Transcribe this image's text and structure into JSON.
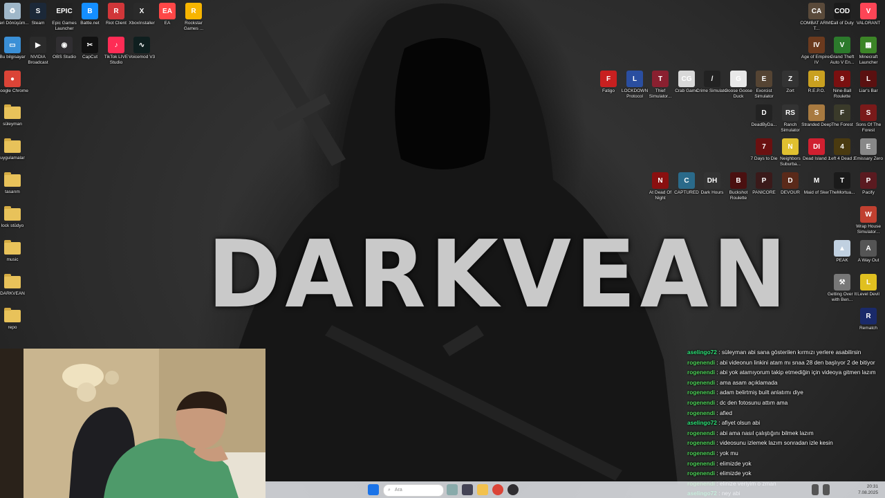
{
  "wallpaper": {
    "title": "DARKVEAN"
  },
  "desktop_left": [
    {
      "label": "Geri Dönüşüm...",
      "icon": "recycle-bin-icon",
      "color": "#9fb7c9",
      "glyph": "♻"
    },
    {
      "label": "Steam",
      "icon": "steam-icon",
      "color": "#1b2838",
      "glyph": "S"
    },
    {
      "label": "Epic Games Launcher",
      "icon": "epic-games-icon",
      "color": "#222",
      "glyph": "EPIC"
    },
    {
      "label": "Battle.net",
      "icon": "battlenet-icon",
      "color": "#148eff",
      "glyph": "B"
    },
    {
      "label": "Riot Client",
      "icon": "riot-client-icon",
      "color": "#d13639",
      "glyph": "R"
    },
    {
      "label": "XboxInstaller",
      "icon": "xbox-icon",
      "color": "#2a2a2a",
      "glyph": "X"
    },
    {
      "label": "EA",
      "icon": "ea-icon",
      "color": "#ff4747",
      "glyph": "EA"
    },
    {
      "label": "Rockstar Games ...",
      "icon": "rockstar-icon",
      "color": "#f7b500",
      "glyph": "R"
    },
    {
      "label": "Bu bilgisayar",
      "icon": "this-pc-icon",
      "color": "#3a8fd6",
      "glyph": "▭"
    },
    {
      "label": "NVIDIA Broadcast",
      "icon": "nvidia-broadcast-icon",
      "color": "#2b2b2b",
      "glyph": "▶"
    },
    {
      "label": "OBS Studio",
      "icon": "obs-icon",
      "color": "#302e31",
      "glyph": "◉"
    },
    {
      "label": "CapCut",
      "icon": "capcut-icon",
      "color": "#111",
      "glyph": "✂"
    },
    {
      "label": "TikTok LIVE Studio",
      "icon": "tiktok-icon",
      "color": "#fe2c55",
      "glyph": "♪"
    },
    {
      "label": "Voicemod V3",
      "icon": "voicemod-icon",
      "color": "#0f1f1f",
      "glyph": "∿"
    },
    {
      "label": "Google Chrome",
      "icon": "chrome-icon",
      "color": "#db4437",
      "glyph": "●"
    },
    {
      "label": "süleyman",
      "icon": "folder-icon",
      "folder": true
    },
    {
      "label": "uygulamalar",
      "icon": "folder-icon",
      "folder": true
    },
    {
      "label": "tasarım",
      "icon": "folder-icon",
      "folder": true
    },
    {
      "label": "lock stüdyo",
      "icon": "folder-icon",
      "folder": true
    },
    {
      "label": "music",
      "icon": "folder-icon",
      "folder": true
    },
    {
      "label": "DARKVEAN",
      "icon": "folder-icon",
      "folder": true
    },
    {
      "label": "repo",
      "icon": "folder-icon",
      "folder": true
    }
  ],
  "desktop_right": [
    {
      "label": "COMBAT ARMS T...",
      "icon": "combat-arms-icon",
      "color": "#5a4a3a",
      "glyph": "CA"
    },
    {
      "label": "Call of Duty",
      "icon": "call-of-duty-icon",
      "color": "#1a1a1a",
      "glyph": "COD"
    },
    {
      "label": "VALORANT",
      "icon": "valorant-icon",
      "color": "#fd4556",
      "glyph": "V"
    },
    {
      "label": "Age of Empires IV",
      "icon": "age-of-empires-icon",
      "color": "#6b3a1e",
      "glyph": "IV"
    },
    {
      "label": "Grand Theft Auto V En...",
      "icon": "gta-icon",
      "color": "#2c7a2c",
      "glyph": "V"
    },
    {
      "label": "Minecraft Launcher",
      "icon": "minecraft-icon",
      "color": "#3c8527",
      "glyph": "▦"
    },
    {
      "label": "Fatigo",
      "icon": "game-icon",
      "color": "#c82020",
      "glyph": "F"
    },
    {
      "label": "LOCKDOWN Protocol",
      "icon": "game-icon",
      "color": "#2a4ea0",
      "glyph": "L"
    },
    {
      "label": "Thief Simulator...",
      "icon": "game-icon",
      "color": "#8a2030",
      "glyph": "T"
    },
    {
      "label": "Crab Game",
      "icon": "game-icon",
      "color": "#d8d8d8",
      "glyph": "CG"
    },
    {
      "label": "Crime Simulator",
      "icon": "game-icon",
      "color": "#222",
      "glyph": "/"
    },
    {
      "label": "Goose Goose Duck",
      "icon": "game-icon",
      "color": "#e8e8e8",
      "glyph": "G"
    },
    {
      "label": "Exorcist Simulator",
      "icon": "game-icon",
      "color": "#554433",
      "glyph": "E"
    },
    {
      "label": "Zort",
      "icon": "game-icon",
      "color": "#333",
      "glyph": "Z"
    },
    {
      "label": "R.E.P.O.",
      "icon": "game-icon",
      "color": "#c9a020",
      "glyph": "R"
    },
    {
      "label": "Nine-Ball Roulette",
      "icon": "game-icon",
      "color": "#7a1010",
      "glyph": "9"
    },
    {
      "label": "Liar's Bar",
      "icon": "game-icon",
      "color": "#5a1010",
      "glyph": "L"
    },
    {
      "label": "DeadByDa...",
      "icon": "game-icon",
      "color": "#222",
      "glyph": "D"
    },
    {
      "label": "Ranch Simulator",
      "icon": "game-icon",
      "color": "#333",
      "glyph": "RS"
    },
    {
      "label": "Stranded Deep",
      "icon": "game-icon",
      "color": "#a87a40",
      "glyph": "S"
    },
    {
      "label": "The Forest",
      "icon": "game-icon",
      "color": "#3a3a2a",
      "glyph": "F"
    },
    {
      "label": "Sons Of The Forest",
      "icon": "game-icon",
      "color": "#7a1a1a",
      "glyph": "S"
    },
    {
      "label": "7 Days to Die",
      "icon": "game-icon",
      "color": "#6a1010",
      "glyph": "7"
    },
    {
      "label": "Neighbors Suburba...",
      "icon": "game-icon",
      "color": "#e0c030",
      "glyph": "N"
    },
    {
      "label": "Dead Island 2",
      "icon": "game-icon",
      "color": "#d02030",
      "glyph": "DI"
    },
    {
      "label": "Left 4 Dead 2",
      "icon": "game-icon",
      "color": "#4a3a10",
      "glyph": "4"
    },
    {
      "label": "Emissary Zero",
      "icon": "game-icon",
      "color": "#888",
      "glyph": "E"
    },
    {
      "label": "At Dead Of Night",
      "icon": "game-icon",
      "color": "#8a1010",
      "glyph": "N"
    },
    {
      "label": "CAPTURED",
      "icon": "game-icon",
      "color": "#2a6a8a",
      "glyph": "C"
    },
    {
      "label": "Dark Hours",
      "icon": "game-icon",
      "color": "#333",
      "glyph": "DH"
    },
    {
      "label": "Buckshot Roulette",
      "icon": "game-icon",
      "color": "#4a1010",
      "glyph": "B"
    },
    {
      "label": "PANICORE",
      "icon": "game-icon",
      "color": "#3a1a1a",
      "glyph": "P"
    },
    {
      "label": "DEVOUR",
      "icon": "game-icon",
      "color": "#5a2a1a",
      "glyph": "D"
    },
    {
      "label": "Maid of Sker",
      "icon": "game-icon",
      "color": "#2a2a2a",
      "glyph": "M"
    },
    {
      "label": "TheMortua...",
      "icon": "game-icon",
      "color": "#1a1a1a",
      "glyph": "T"
    },
    {
      "label": "Pacify",
      "icon": "game-icon",
      "color": "#5a1a20",
      "glyph": "P"
    },
    {
      "label": "Wrap House Simulator...",
      "icon": "game-icon",
      "color": "#c04030",
      "glyph": "W"
    },
    {
      "label": "PEAK",
      "icon": "game-icon",
      "color": "#c0d0e0",
      "glyph": "▲"
    },
    {
      "label": "A Way Out",
      "icon": "game-icon",
      "color": "#555",
      "glyph": "A"
    },
    {
      "label": "Getting Over It with Ben...",
      "icon": "game-icon",
      "color": "#777",
      "glyph": "⚒"
    },
    {
      "label": "Level Devil",
      "icon": "game-icon",
      "color": "#e0c020",
      "glyph": "L"
    },
    {
      "label": "Rematch",
      "icon": "game-icon",
      "color": "#1a2a6a",
      "glyph": "R"
    }
  ],
  "chat": [
    {
      "user": "aselingo72",
      "color": "#2ee87a",
      "msg": "süleyman abi sana gösterilen kırmızı yerlere asabilirsin"
    },
    {
      "user": "rogenendi",
      "color": "#4fd65a",
      "msg": "abi videonun linkini atam mı snaa 28 den başlıyor 2 de bitiyor"
    },
    {
      "user": "rogenendi",
      "color": "#4fd65a",
      "msg": "abi yok atamıyorum takip etmediğin için videoya gitmen lazım"
    },
    {
      "user": "rogenendi",
      "color": "#4fd65a",
      "msg": "ama asam açıklamada"
    },
    {
      "user": "rogenendi",
      "color": "#4fd65a",
      "msg": "adam belirtmiş built anlatımı diye"
    },
    {
      "user": "rogenendi",
      "color": "#4fd65a",
      "msg": "dc den fotosunu attım ama"
    },
    {
      "user": "rogenendi",
      "color": "#4fd65a",
      "msg": "afied"
    },
    {
      "user": "aselingo72",
      "color": "#2ee87a",
      "msg": "afiyet olsun abi"
    },
    {
      "user": "rogenendi",
      "color": "#4fd65a",
      "msg": "abi ama nasıl çalıştığını bilmek lazım"
    },
    {
      "user": "rogenendi",
      "color": "#4fd65a",
      "msg": "videosunu izlemek lazım sonradan izle kesin"
    },
    {
      "user": "rogenendi",
      "color": "#4fd65a",
      "msg": "yok mu"
    },
    {
      "user": "rogenendi",
      "color": "#4fd65a",
      "msg": "elimizde yok"
    },
    {
      "user": "rogenendi",
      "color": "#4fd65a",
      "msg": "elimizde yok"
    },
    {
      "user": "rogenendi",
      "color": "#4fd65a",
      "msg": "elinize veriyim o zman"
    },
    {
      "user": "aselingo72",
      "color": "#2ee87a",
      "msg": "ney abi"
    }
  ],
  "taskbar": {
    "search_placeholder": "Ara",
    "time": "20:31",
    "date": "7.08.2025"
  }
}
